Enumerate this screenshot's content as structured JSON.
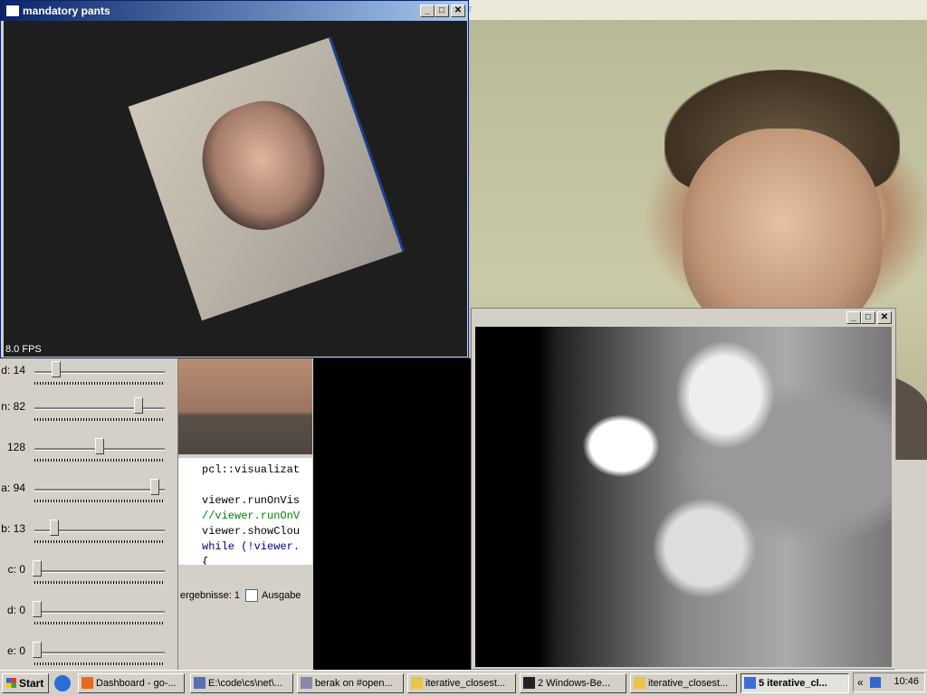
{
  "cam_window": {
    "title_fragment": "r"
  },
  "pcl_window": {
    "title": "mandatory pants",
    "fps": "8.0 FPS",
    "buttons": {
      "minimize": "_",
      "maximize": "□",
      "close": "✕"
    }
  },
  "sliders": [
    {
      "label": "d: 14",
      "value": 14
    },
    {
      "label": "n: 82",
      "value": 82
    },
    {
      "label": "128",
      "value": 128
    },
    {
      "label": "a: 94",
      "value": 94
    },
    {
      "label": "b: 13",
      "value": 13
    },
    {
      "label": "c: 0",
      "value": 0
    },
    {
      "label": "d: 0",
      "value": 0
    },
    {
      "label": "e: 0",
      "value": 0
    }
  ],
  "code": [
    {
      "text": "pcl::visualizat",
      "color": "#000000"
    },
    {
      "text": "",
      "color": "#000000"
    },
    {
      "text": "viewer.runOnVis",
      "color": "#000000"
    },
    {
      "text": "//viewer.runOnV",
      "color": "#008000"
    },
    {
      "text": "viewer.showClou",
      "color": "#000000"
    },
    {
      "text": "while (!viewer.",
      "color": "#000080"
    },
    {
      "text": "{",
      "color": "#000000"
    }
  ],
  "tabs": {
    "results": "ergebnisse: 1",
    "output": "Ausgabe"
  },
  "depth_window": {
    "buttons": {
      "minimize": "_",
      "maximize": "□",
      "close": "✕"
    }
  },
  "taskbar": {
    "start": "Start",
    "tasks": [
      {
        "label": "Dashboard - go-...",
        "icon": "firefox-icon"
      },
      {
        "label": "E:\\code\\cs\\net\\...",
        "icon": "editor-icon"
      },
      {
        "label": "berak on #open...",
        "icon": "chat-icon"
      },
      {
        "label": "iterative_closest...",
        "icon": "folder-icon"
      },
      {
        "label": "2 Windows-Be...",
        "icon": "console-icon"
      },
      {
        "label": "iterative_closest...",
        "icon": "folder-icon"
      },
      {
        "label": "5 iterative_cl...",
        "icon": "window-icon"
      }
    ],
    "tray_arrow": "«",
    "clock": "10:46"
  }
}
